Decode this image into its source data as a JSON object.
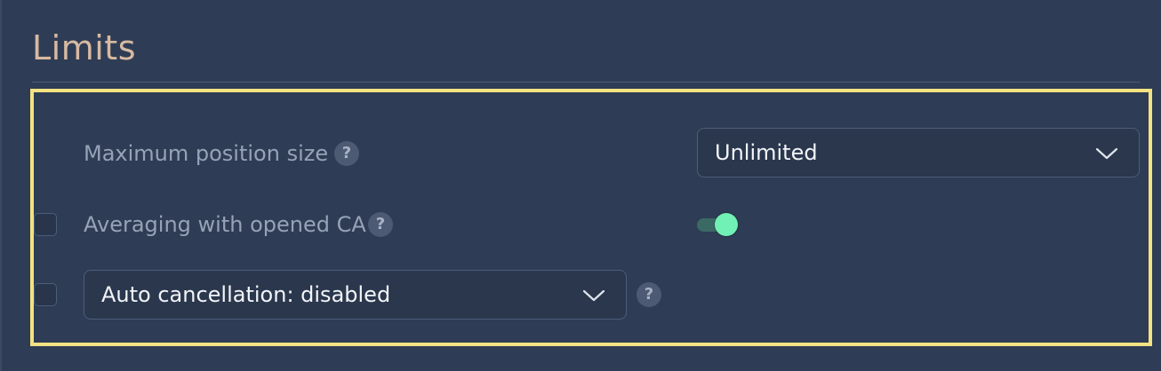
{
  "section": {
    "title": "Limits"
  },
  "rows": {
    "max_position": {
      "label": "Maximum position size",
      "help": "?",
      "select_value": "Unlimited"
    },
    "averaging": {
      "label": "Averaging with opened CA",
      "help": "?",
      "toggle_on": true
    },
    "auto_cancel": {
      "select_value": "Auto cancellation: disabled",
      "help": "?"
    }
  },
  "colors": {
    "background": "#2e3d55",
    "title": "#d8b9a3",
    "highlight_border": "#f3e282",
    "toggle_knob": "#71f1b5",
    "toggle_track": "#3b6a64"
  },
  "icons": {
    "help": "question-mark-circle",
    "dropdown": "chevron-down"
  }
}
